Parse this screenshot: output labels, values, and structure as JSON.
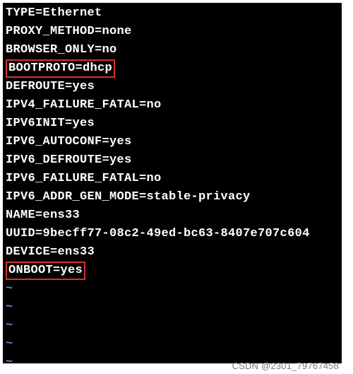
{
  "config_lines": [
    {
      "text": "TYPE=Ethernet",
      "highlight": false
    },
    {
      "text": "PROXY_METHOD=none",
      "highlight": false
    },
    {
      "text": "BROWSER_ONLY=no",
      "highlight": false
    },
    {
      "text": "BOOTPROTO=dhcp",
      "highlight": true
    },
    {
      "text": "DEFROUTE=yes",
      "highlight": false
    },
    {
      "text": "IPV4_FAILURE_FATAL=no",
      "highlight": false
    },
    {
      "text": "IPV6INIT=yes",
      "highlight": false
    },
    {
      "text": "IPV6_AUTOCONF=yes",
      "highlight": false
    },
    {
      "text": "IPV6_DEFROUTE=yes",
      "highlight": false
    },
    {
      "text": "IPV6_FAILURE_FATAL=no",
      "highlight": false
    },
    {
      "text": "IPV6_ADDR_GEN_MODE=stable-privacy",
      "highlight": false
    },
    {
      "text": "NAME=ens33",
      "highlight": false
    },
    {
      "text": "UUID=9becff77-08c2-49ed-bc63-8407e707c604",
      "highlight": false
    },
    {
      "text": "DEVICE=ens33",
      "highlight": false
    },
    {
      "text": "ONBOOT=yes",
      "highlight": true
    }
  ],
  "tilde_char": "~",
  "tilde_count": 5,
  "watermark": "CSDN @2301_79767458"
}
